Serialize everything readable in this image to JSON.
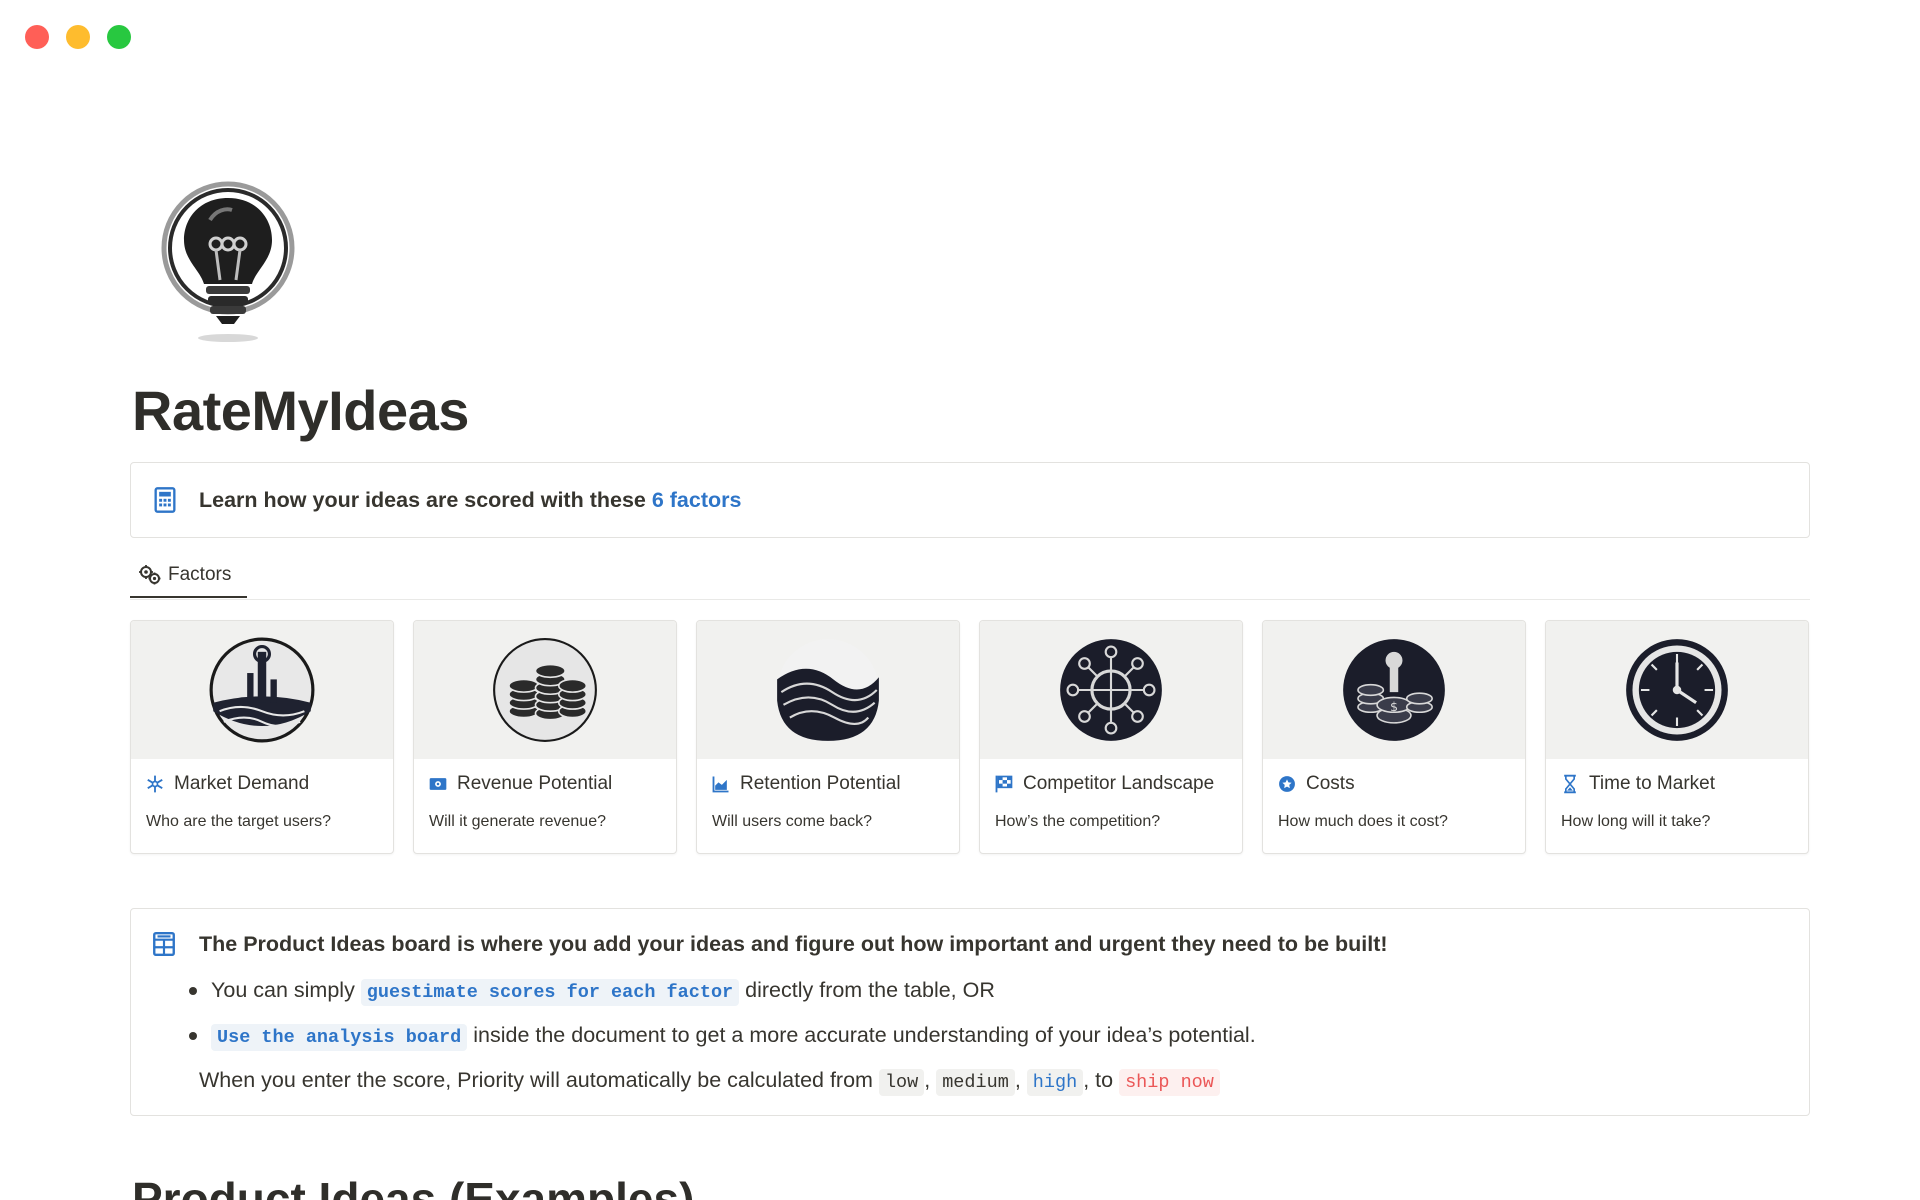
{
  "page": {
    "title": "RateMyIdeas",
    "icon": "lightbulb-icon"
  },
  "intro_callout": {
    "icon": "calculator-icon",
    "text": "Learn how your ideas are scored with these ",
    "link_text": "6 factors"
  },
  "tabs": [
    {
      "label": "Factors",
      "icon": "gears-icon",
      "active": true
    }
  ],
  "factors": [
    {
      "name": "Market Demand",
      "description": "Who are the target users?",
      "icon": "snowflake-icon",
      "cover": "market-globe-image"
    },
    {
      "name": "Revenue Potential",
      "description": "Will it generate revenue?",
      "icon": "banknote-icon",
      "cover": "coin-stacks-image"
    },
    {
      "name": "Retention Potential",
      "description": "Will users come back?",
      "icon": "area-chart-icon",
      "cover": "waves-image"
    },
    {
      "name": "Competitor Landscape",
      "description": "How’s the competition?",
      "icon": "chess-board-icon",
      "cover": "network-hub-image"
    },
    {
      "name": "Costs",
      "description": "How much does it cost?",
      "icon": "coin-icon",
      "cover": "cost-coins-image"
    },
    {
      "name": "Time to Market",
      "description": "How long will it take?",
      "icon": "hourglass-icon",
      "cover": "clock-image"
    }
  ],
  "board_callout": {
    "icon": "board-icon",
    "heading": "The Product Ideas board is where you add your ideas and figure out how important and urgent they need to be built!",
    "bullet1_prefix": "You can simply ",
    "bullet1_code": "guestimate scores for each factor",
    "bullet1_suffix": " directly from the table, OR",
    "bullet2_code": "Use the analysis board",
    "bullet2_suffix": " inside the document to get a more accurate understanding of your idea’s potential.",
    "line_prefix": "When you enter the score, Priority will automatically be calculated from ",
    "levels": [
      "low",
      "medium",
      "high",
      "ship now"
    ],
    "sep1": ", ",
    "sep2": ", ",
    "sep3": ", to "
  },
  "next_heading": "Product Ideas (Examples)",
  "colors": {
    "accent_blue": "#2e75c8",
    "red_code": "#eb5757",
    "text": "#37352f"
  }
}
